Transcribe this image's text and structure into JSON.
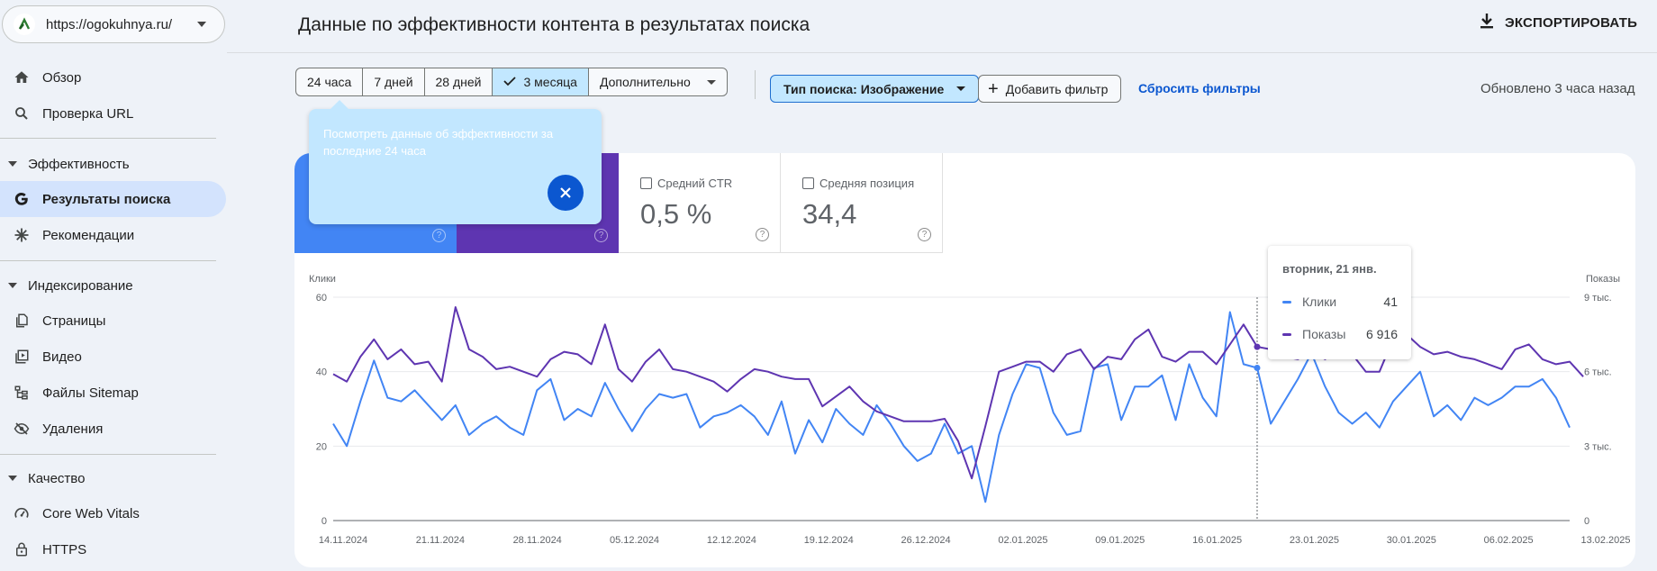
{
  "site": {
    "url": "https://ogokuhnya.ru/"
  },
  "sidebar": {
    "items": [
      {
        "label": "Обзор",
        "icon": "home-icon"
      },
      {
        "label": "Проверка URL",
        "icon": "search-icon"
      },
      {
        "label": "Эффективность",
        "type": "section"
      },
      {
        "label": "Результаты поиска",
        "icon": "google-icon",
        "active": true
      },
      {
        "label": "Рекомендации",
        "icon": "sparkle-icon"
      },
      {
        "label": "Индексирование",
        "type": "section"
      },
      {
        "label": "Страницы",
        "icon": "pages-icon"
      },
      {
        "label": "Видео",
        "icon": "video-icon"
      },
      {
        "label": "Файлы Sitemap",
        "icon": "sitemap-icon"
      },
      {
        "label": "Удаления",
        "icon": "eye-off-icon"
      },
      {
        "label": "Качество",
        "type": "section"
      },
      {
        "label": "Core Web Vitals",
        "icon": "gauge-icon"
      },
      {
        "label": "HTTPS",
        "icon": "lock-icon"
      }
    ]
  },
  "header": {
    "title": "Данные по эффективности контента в результатах поиска",
    "export_label": "ЭКСПОРТИРОВАТЬ"
  },
  "filters": {
    "ranges": [
      "24 часа",
      "7 дней",
      "28 дней",
      "3 месяца",
      "Дополнительно"
    ],
    "selected_range": "3 месяца",
    "search_type": "Тип поиска: Изображение",
    "add_filter": "Добавить фильтр",
    "reset": "Сбросить фильтры",
    "updated": "Обновлено 3 часа назад"
  },
  "popup": {
    "text": "Посмотреть данные об эффективности за последние 24 часа"
  },
  "metrics": {
    "ctr": {
      "label": "Средний CTR",
      "value": "0,5 %"
    },
    "position": {
      "label": "Средняя позиция",
      "value": "34,4"
    }
  },
  "tooltip": {
    "date": "вторник, 21 янв.",
    "clicks_label": "Клики",
    "clicks_value": "41",
    "impr_label": "Показы",
    "impr_value": "6 916"
  },
  "colors": {
    "clicks": "#4285f4",
    "impressions": "#5e35b1",
    "accent": "#0b57d0"
  },
  "chart_data": {
    "type": "line",
    "y_left_label": "Клики",
    "y_right_label": "Показы",
    "y_left_ticks": [
      "0",
      "20",
      "40",
      "60"
    ],
    "y_right_ticks": [
      "0",
      "3 тыс.",
      "6 тыс.",
      "9 тыс."
    ],
    "ylim_left": [
      0,
      60
    ],
    "ylim_right": [
      0,
      9000
    ],
    "x_ticks": [
      "14.11.2024",
      "21.11.2024",
      "28.11.2024",
      "05.12.2024",
      "12.12.2024",
      "19.12.2024",
      "26.12.2024",
      "02.01.2025",
      "09.01.2025",
      "16.01.2025",
      "23.01.2025",
      "30.01.2025",
      "06.02.2025",
      "13.02.2025"
    ],
    "highlight_index": 68,
    "series": [
      {
        "name": "Клики",
        "axis": "left",
        "values": [
          26,
          20,
          32,
          43,
          33,
          32,
          35,
          31,
          27,
          31,
          23,
          26,
          28,
          25,
          23,
          35,
          38,
          27,
          30,
          28,
          37,
          30,
          24,
          30,
          34,
          33,
          34,
          25,
          28,
          29,
          31,
          28,
          23,
          32,
          18,
          27,
          21,
          30,
          26,
          23,
          31,
          26,
          20,
          16,
          18,
          26,
          18,
          20,
          5,
          23,
          34,
          42,
          41,
          29,
          23,
          24,
          41,
          42,
          27,
          36,
          36,
          39,
          27,
          42,
          33,
          28,
          56,
          42,
          41,
          26,
          32,
          38,
          45,
          36,
          29,
          26,
          29,
          25,
          32,
          36,
          40,
          28,
          31,
          27,
          33,
          31,
          33,
          36,
          36,
          38,
          33,
          25
        ]
      },
      {
        "name": "Показы",
        "axis": "right",
        "values": [
          5900,
          5600,
          6600,
          7300,
          6500,
          6900,
          6300,
          6400,
          5600,
          8600,
          6900,
          6600,
          6100,
          6200,
          6000,
          5800,
          6500,
          6800,
          6700,
          6300,
          7900,
          6100,
          5600,
          6400,
          6900,
          6100,
          6000,
          5800,
          5600,
          5200,
          5700,
          6100,
          6000,
          5800,
          5700,
          5700,
          4600,
          5000,
          5400,
          4800,
          4400,
          4200,
          4000,
          4000,
          4000,
          4100,
          3200,
          1700,
          3800,
          6000,
          6200,
          6400,
          6400,
          6000,
          6700,
          6900,
          6100,
          6600,
          6500,
          7300,
          7700,
          6600,
          6400,
          6800,
          6800,
          6300,
          7100,
          7900,
          7000,
          6900,
          6600,
          6500,
          6800,
          6500,
          6900,
          6700,
          6000,
          6000,
          7300,
          7500,
          7000,
          6700,
          6800,
          6600,
          6500,
          6300,
          6100,
          6900,
          7100,
          6500,
          6300,
          6400,
          5800
        ]
      }
    ]
  }
}
